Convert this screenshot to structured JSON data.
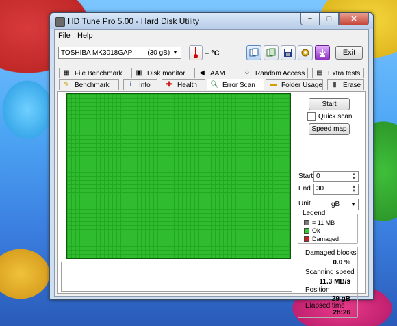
{
  "window": {
    "title": "HD Tune Pro 5.00 - Hard Disk Utility"
  },
  "window_buttons": {
    "minimize": "−",
    "maximize": "□",
    "close": "✕"
  },
  "menu": {
    "file": "File",
    "help": "Help"
  },
  "toolbar": {
    "drive": "TOSHIBA MK3018GAP        (30 gB)",
    "temperature": "– °C",
    "exit_label": "Exit"
  },
  "tabs_top": [
    {
      "label": "File Benchmark",
      "icon": "file-benchmark-icon"
    },
    {
      "label": "Disk monitor",
      "icon": "disk-monitor-icon"
    },
    {
      "label": "AAM",
      "icon": "speaker-icon"
    },
    {
      "label": "Random Access",
      "icon": "random-access-icon"
    },
    {
      "label": "Extra tests",
      "icon": "extra-tests-icon"
    }
  ],
  "tabs_bottom": [
    {
      "label": "Benchmark",
      "icon": "benchmark-icon"
    },
    {
      "label": "Info",
      "icon": "info-icon"
    },
    {
      "label": "Health",
      "icon": "health-icon"
    },
    {
      "label": "Error Scan",
      "icon": "magnifier-icon",
      "active": true
    },
    {
      "label": "Folder Usage",
      "icon": "folder-icon"
    },
    {
      "label": "Erase",
      "icon": "trash-icon"
    }
  ],
  "error_scan": {
    "start_label": "Start",
    "quick_scan_label": "Quick scan",
    "speed_map_label": "Speed map",
    "start_field_label": "Start",
    "start_value": "0",
    "end_field_label": "End",
    "end_value": "30",
    "unit_label": "Unit",
    "unit_value": "gB",
    "legend": {
      "title": "Legend",
      "items": [
        {
          "label": "= 11 MB",
          "color": "#7a7a7a"
        },
        {
          "label": "Ok",
          "color": "#2ecc2e"
        },
        {
          "label": "Damaged",
          "color": "#cc2020"
        }
      ]
    },
    "stats": {
      "damaged_blocks_label": "Damaged blocks",
      "damaged_blocks_value": "0.0 %",
      "scanning_speed_label": "Scanning speed",
      "scanning_speed_value": "11.3 MB/s",
      "position_label": "Position",
      "position_value": "29 gB",
      "elapsed_label": "Elapsed time",
      "elapsed_value": "28:26"
    }
  },
  "colors": {
    "block_ok": "#2ecc2e",
    "block_grid": "#0a5a0a"
  }
}
